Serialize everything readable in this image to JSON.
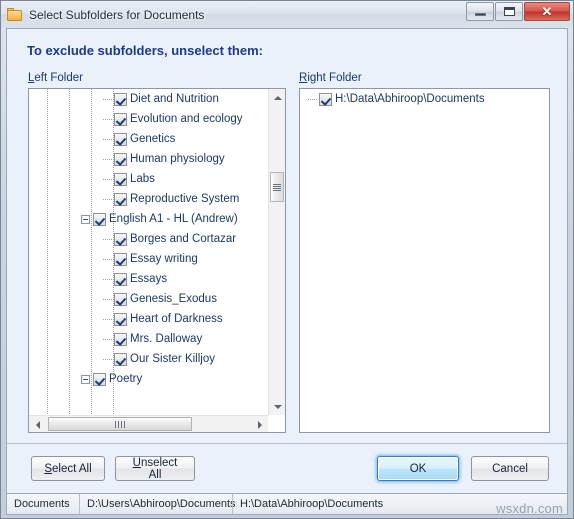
{
  "window": {
    "title": "Select Subfolders for Documents",
    "icon": "folder-icon",
    "minimize_label": "",
    "maximize_label": "",
    "close_label": "✕"
  },
  "headline": "To exclude subfolders, unselect them:",
  "left_panel": {
    "label_prefix": "L",
    "label_rest": "eft Folder",
    "nodes": [
      {
        "indent": 4,
        "expander": "none",
        "checked": true,
        "label": "Diet and Nutrition"
      },
      {
        "indent": 4,
        "expander": "none",
        "checked": true,
        "label": "Evolution and ecology"
      },
      {
        "indent": 4,
        "expander": "none",
        "checked": true,
        "label": "Genetics"
      },
      {
        "indent": 4,
        "expander": "none",
        "checked": true,
        "label": "Human physiology"
      },
      {
        "indent": 4,
        "expander": "none",
        "checked": true,
        "label": "Labs"
      },
      {
        "indent": 4,
        "expander": "none",
        "checked": true,
        "label": "Reproductive System"
      },
      {
        "indent": 3,
        "expander": "minus",
        "checked": true,
        "label": "English A1 - HL (Andrew)"
      },
      {
        "indent": 4,
        "expander": "none",
        "checked": true,
        "label": "Borges and Cortazar"
      },
      {
        "indent": 4,
        "expander": "none",
        "checked": true,
        "label": "Essay writing"
      },
      {
        "indent": 4,
        "expander": "none",
        "checked": true,
        "label": "Essays"
      },
      {
        "indent": 4,
        "expander": "none",
        "checked": true,
        "label": "Genesis_Exodus"
      },
      {
        "indent": 4,
        "expander": "none",
        "checked": true,
        "label": "Heart of Darkness"
      },
      {
        "indent": 4,
        "expander": "none",
        "checked": true,
        "label": "Mrs. Dalloway"
      },
      {
        "indent": 4,
        "expander": "none",
        "checked": true,
        "label": "Our Sister Killjoy"
      },
      {
        "indent": 3,
        "expander": "minus",
        "checked": true,
        "label": "Poetry"
      }
    ]
  },
  "right_panel": {
    "label_prefix": "R",
    "label_rest": "ight Folder",
    "nodes": [
      {
        "indent": 1,
        "expander": "none",
        "checked": true,
        "label": "H:\\Data\\Abhiroop\\Documents"
      }
    ]
  },
  "buttons": {
    "select_all_accel": "S",
    "select_all_rest": "elect All",
    "unselect_all_accel": "U",
    "unselect_all_rest": "nselect All",
    "ok": "OK",
    "cancel": "Cancel"
  },
  "statusbar": {
    "cell1": "Documents",
    "cell2": "D:\\Users\\Abhiroop\\Documents",
    "cell3": "H:\\Data\\Abhiroop\\Documents"
  },
  "watermark": "wsxdn.com"
}
